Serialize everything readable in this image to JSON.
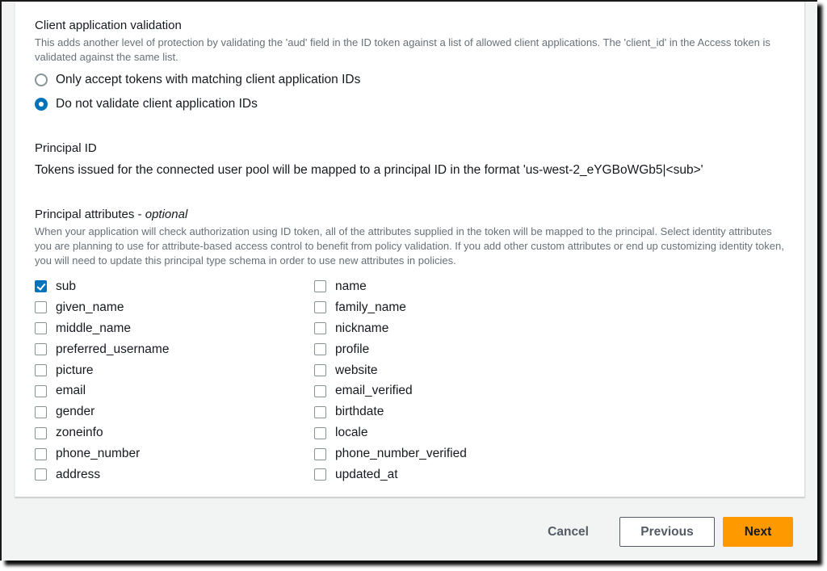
{
  "client_validation": {
    "label": "Client application validation",
    "description": "This adds another level of protection by validating the 'aud' field in the ID token against a list of allowed client applications. The 'client_id' in the Access token is validated against the same list.",
    "options": [
      {
        "label": "Only accept tokens with matching client application IDs",
        "selected": false
      },
      {
        "label": "Do not validate client application IDs",
        "selected": true
      }
    ]
  },
  "principal_id": {
    "label": "Principal ID",
    "value": "Tokens issued for the connected user pool will be mapped to a principal ID in the format 'us-west-2_eYGBoWGb5|<sub>'"
  },
  "principal_attributes": {
    "label": "Principal attributes - ",
    "label_optional": "optional",
    "description": "When your application will check authorization using ID token, all of the attributes supplied in the token will be mapped to the principal. Select identity attributes you are planning to use for attribute-based access control to benefit from policy validation. If you add other custom attributes or end up customizing identity token, you will need to update this principal type schema in order to use new attributes in policies.",
    "column1": [
      {
        "label": "sub",
        "checked": true
      },
      {
        "label": "given_name",
        "checked": false
      },
      {
        "label": "middle_name",
        "checked": false
      },
      {
        "label": "preferred_username",
        "checked": false
      },
      {
        "label": "picture",
        "checked": false
      },
      {
        "label": "email",
        "checked": false
      },
      {
        "label": "gender",
        "checked": false
      },
      {
        "label": "zoneinfo",
        "checked": false
      },
      {
        "label": "phone_number",
        "checked": false
      },
      {
        "label": "address",
        "checked": false
      }
    ],
    "column2": [
      {
        "label": "name",
        "checked": false
      },
      {
        "label": "family_name",
        "checked": false
      },
      {
        "label": "nickname",
        "checked": false
      },
      {
        "label": "profile",
        "checked": false
      },
      {
        "label": "website",
        "checked": false
      },
      {
        "label": "email_verified",
        "checked": false
      },
      {
        "label": "birthdate",
        "checked": false
      },
      {
        "label": "locale",
        "checked": false
      },
      {
        "label": "phone_number_verified",
        "checked": false
      },
      {
        "label": "updated_at",
        "checked": false
      }
    ]
  },
  "footer": {
    "cancel_label": "Cancel",
    "previous_label": "Previous",
    "next_label": "Next"
  },
  "colors": {
    "accent": "#0073bb",
    "primary_button": "#ff9900",
    "background": "#f2f3f3"
  }
}
